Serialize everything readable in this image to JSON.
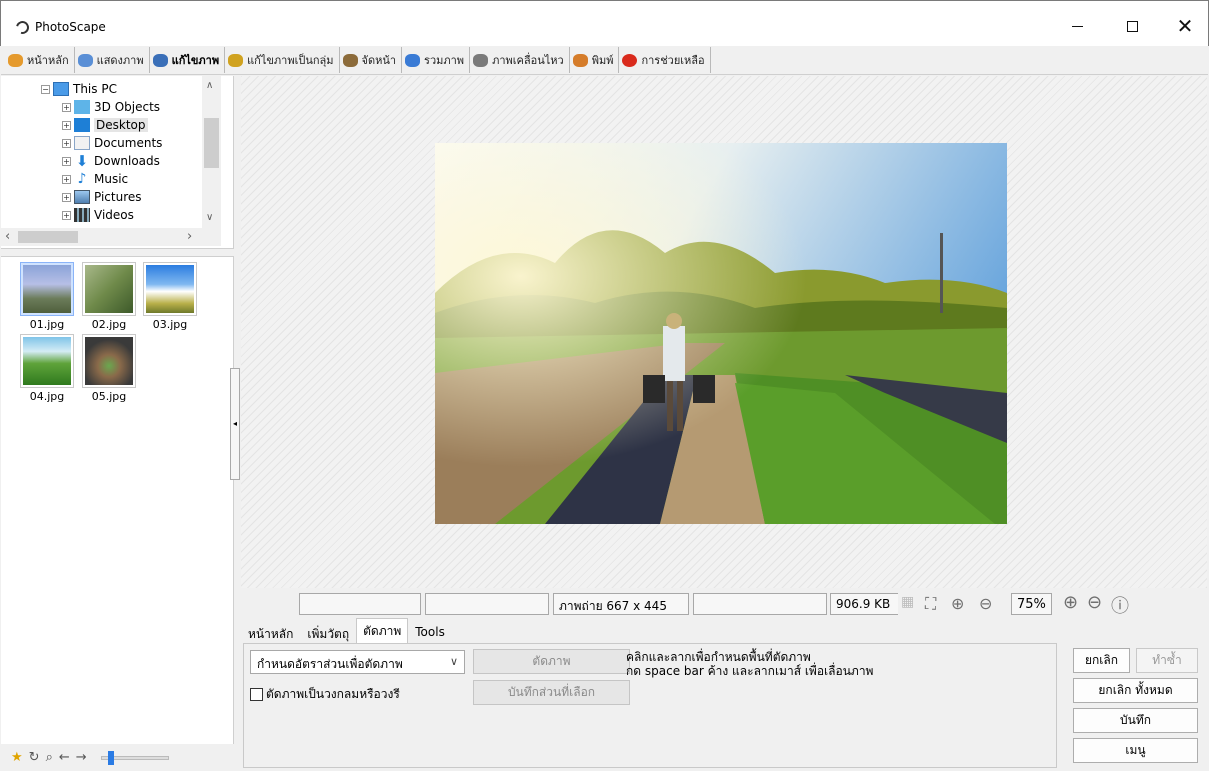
{
  "window": {
    "title": "PhotoScape",
    "min_icon": "minimize-icon",
    "max_icon": "maximize-icon",
    "close_label": "✕"
  },
  "tabs": [
    {
      "label": "หน้าหลัก",
      "color": "#e59a2d"
    },
    {
      "label": "แสดงภาพ",
      "color": "#5a8fd6"
    },
    {
      "label": "แก้ไขภาพ",
      "color": "#3a6fb8",
      "active": true
    },
    {
      "label": "แก้ไขภาพเป็นกลุ่ม",
      "color": "#d0a21f"
    },
    {
      "label": "จัดหน้า",
      "color": "#8c6b3a"
    },
    {
      "label": "รวมภาพ",
      "color": "#3a7bd5"
    },
    {
      "label": "ภาพเคลื่อนไหว",
      "color": "#7a7a7a"
    },
    {
      "label": "พิมพ์",
      "color": "#d57c2a"
    },
    {
      "label": "การช่วยเหลือ",
      "color": "#d92a1c"
    }
  ],
  "tree": {
    "root": "This PC",
    "items": [
      "3D Objects",
      "Desktop",
      "Documents",
      "Downloads",
      "Music",
      "Pictures",
      "Videos"
    ],
    "selected": "Desktop"
  },
  "thumbnails": [
    "01.jpg",
    "02.jpg",
    "03.jpg",
    "04.jpg",
    "05.jpg"
  ],
  "status": {
    "box1": "",
    "box2": "",
    "photo_info": "ภาพถ่าย 667 x 445",
    "box4": "",
    "filesize": "906.9 KB",
    "zoom": "75%"
  },
  "panel_tabs": [
    "หน้าหลัก",
    "เพิ่มวัตถุ",
    "ตัดภาพ",
    "Tools"
  ],
  "active_panel_tab": "ตัดภาพ",
  "crop": {
    "select_value": "กำหนดอัตราส่วนเพื่อตัดภาพ",
    "checkbox_label": "ตัดภาพเป็นวงกลมหรือวงรี",
    "crop_button": "ตัดภาพ",
    "save_selection_button": "บันทึกส่วนที่เลือก",
    "hint_line1": "คลิกและลากเพื่อกำหนดพื้นที่ตัดภาพ",
    "hint_line2": "กด space bar ค้าง และลากเมาส์ เพื่อเลื่อนภาพ"
  },
  "actions": {
    "undo": "ยกเลิก",
    "redo": "ทำซ้ำ",
    "undo_all": "ยกเลิก ทั้งหมด",
    "save": "บันทึก",
    "menu": "เมนู"
  }
}
